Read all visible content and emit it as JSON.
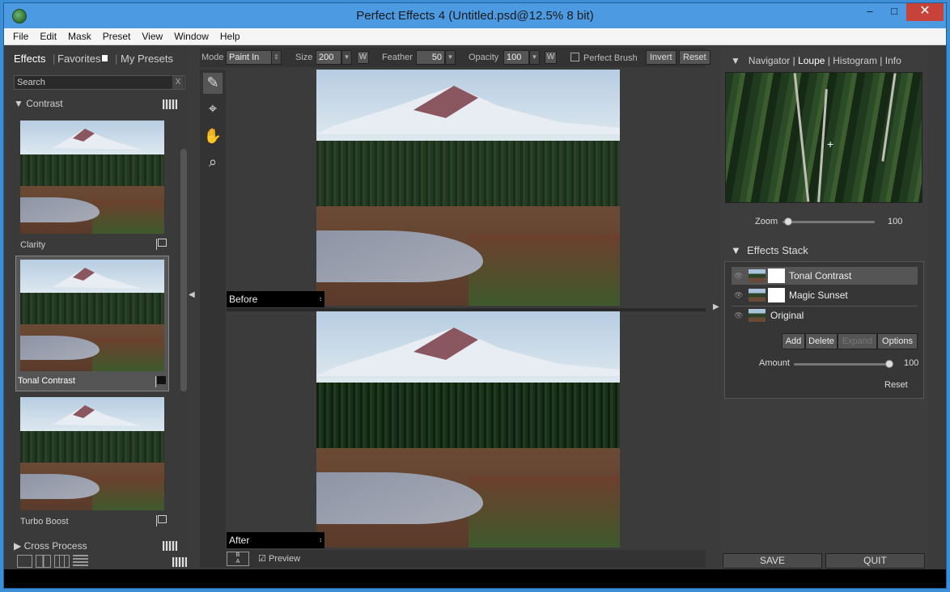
{
  "window": {
    "title": "Perfect Effects 4 (Untitled.psd@12.5% 8 bit)",
    "min": "–",
    "max": "□",
    "close": "✕"
  },
  "menu": [
    "File",
    "Edit",
    "Mask",
    "Preset",
    "View",
    "Window",
    "Help"
  ],
  "left": {
    "tabs": {
      "effects": "Effects",
      "favorites": "Favorites",
      "presets": "My Presets",
      "sep": "|"
    },
    "search_placeholder": "Search",
    "search_clear": "X",
    "section_contrast": "Contrast",
    "section_cross": "Cross Process",
    "thumbs": [
      {
        "label": "Clarity"
      },
      {
        "label": "Tonal Contrast"
      },
      {
        "label": "Turbo Boost"
      }
    ]
  },
  "toolbar": {
    "mode_label": "Mode",
    "mode_value": "Paint In",
    "size_label": "Size",
    "size_value": "200",
    "feather_label": "Feather",
    "feather_value": "50",
    "opacity_label": "Opacity",
    "opacity_value": "100",
    "w": "W",
    "perfect_brush": "Perfect Brush",
    "invert": "Invert",
    "reset": "Reset"
  },
  "canvas": {
    "before": "Before",
    "after": "After",
    "caret": "↕"
  },
  "bottom": {
    "ba_top": "B",
    "ba_bottom": "A",
    "preview": "Preview"
  },
  "right": {
    "nav_tabs": {
      "navigator": "Navigator",
      "loupe": "Loupe",
      "histogram": "Histogram",
      "info": "Info",
      "sep": "|"
    },
    "zoom_label": "Zoom",
    "zoom_value": "100",
    "stack_title": "Effects Stack",
    "stack": [
      {
        "label": "Tonal Contrast"
      },
      {
        "label": "Magic Sunset"
      },
      {
        "label": "Original"
      }
    ],
    "buttons": {
      "add": "Add",
      "delete": "Delete",
      "expand": "Expand",
      "options": "Options"
    },
    "amount_label": "Amount",
    "amount_value": "100",
    "reset": "Reset",
    "save": "SAVE",
    "quit": "QUIT"
  }
}
